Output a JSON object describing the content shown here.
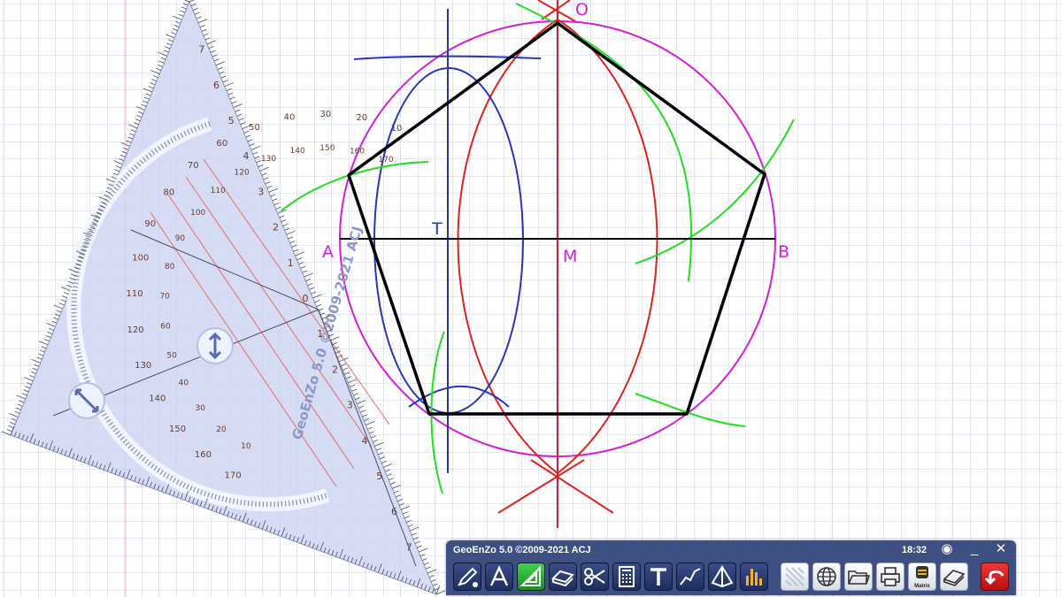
{
  "points": {
    "O": "O",
    "A": "A",
    "B": "B",
    "M": "M",
    "T": "T"
  },
  "set_square": {
    "brand": "GeoEnZo 5.0 ©2009-2021 ACJ",
    "protractor_outer": [
      "10",
      "20",
      "30",
      "40",
      "50",
      "60",
      "70",
      "80",
      "90",
      "100",
      "110",
      "120",
      "130",
      "140",
      "150",
      "160",
      "170"
    ],
    "protractor_inner": [
      "170",
      "160",
      "150",
      "140",
      "130",
      "120",
      "110",
      "100",
      "90",
      "80",
      "70",
      "60",
      "50",
      "40",
      "30",
      "20",
      "10"
    ],
    "scale": [
      "7",
      "6",
      "5",
      "4",
      "3",
      "2",
      "1",
      "0",
      "1",
      "2",
      "3",
      "4",
      "5",
      "6",
      "7"
    ]
  },
  "toolbar": {
    "title": "GeoEnZo 5.0 ©2009-2021 ACJ",
    "time": "18:32",
    "minimize": "_",
    "close": "✕",
    "record": "◉",
    "matrix_label": "Matrix",
    "tools": [
      {
        "name": "pen-tool-button",
        "icon": "pen-icon"
      },
      {
        "name": "text-style-tool-button",
        "icon": "letter-a-icon"
      },
      {
        "name": "set-square-tool-button",
        "icon": "set-square-icon"
      },
      {
        "name": "eraser-tool-button",
        "icon": "eraser-icon"
      },
      {
        "name": "scissors-tool-button",
        "icon": "scissors-icon"
      },
      {
        "name": "calculator-tool-button",
        "icon": "calculator-icon"
      },
      {
        "name": "text-tool-button",
        "icon": "letter-t-icon"
      },
      {
        "name": "graph-tool-button",
        "icon": "graph-icon"
      },
      {
        "name": "solid-tool-button",
        "icon": "pyramid-icon"
      },
      {
        "name": "chart-tool-button",
        "icon": "bar-chart-icon"
      },
      {
        "name": "grid-tool-button",
        "icon": "grid-icon"
      },
      {
        "name": "globe-tool-button",
        "icon": "globe-icon"
      },
      {
        "name": "open-folder-button",
        "icon": "folder-icon"
      },
      {
        "name": "print-button",
        "icon": "printer-icon"
      },
      {
        "name": "matrix-button",
        "icon": "matrix-icon"
      },
      {
        "name": "clear-board-button",
        "icon": "eraser-board-icon"
      },
      {
        "name": "undo-button",
        "icon": "undo-icon"
      }
    ]
  },
  "colors": {
    "grid": "#c9cdf0",
    "grid_major": "#f0b8b8",
    "pentagon": "#000000",
    "circle": "#d21fd6",
    "construction_red": "#e0221f",
    "construction_blue": "#2438b8",
    "construction_green": "#22dd22",
    "toolbar_bg": "#3e4f82",
    "active_tool": "#2db83a",
    "undo": "#e02020"
  }
}
